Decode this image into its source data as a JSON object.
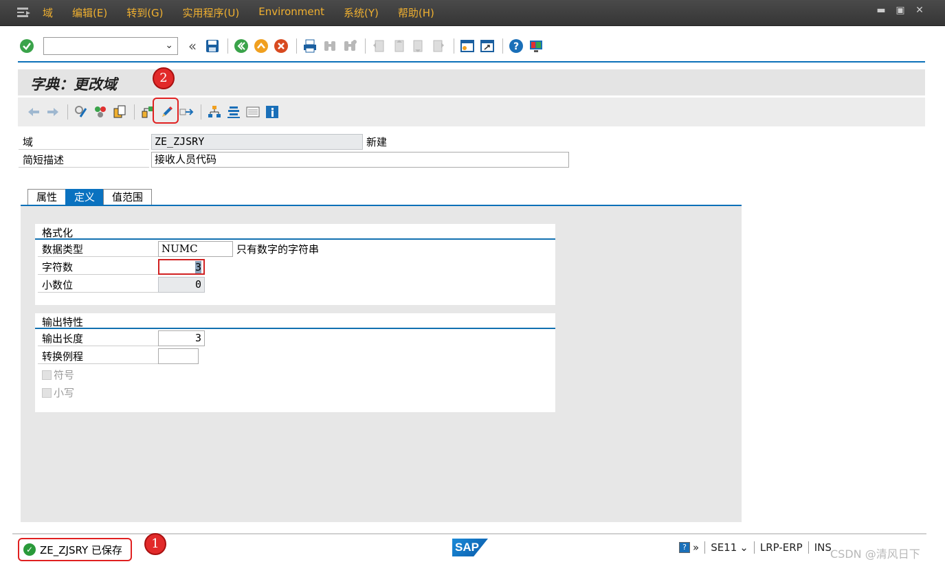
{
  "menubar": {
    "items": [
      "域",
      "编辑(E)",
      "转到(G)",
      "实用程序(U)",
      "Environment",
      "系统(Y)",
      "帮助(H)"
    ]
  },
  "header": {
    "title": "字典：更改域"
  },
  "fields": {
    "domain_label": "域",
    "domain_value": "ZE_ZJSRY",
    "domain_status": "新建",
    "desc_label": "简短描述",
    "desc_value": "接收人员代码"
  },
  "tabs": [
    {
      "label": "属性",
      "active": false
    },
    {
      "label": "定义",
      "active": true
    },
    {
      "label": "值范围",
      "active": false
    }
  ],
  "format_group": {
    "title": "格式化",
    "datatype_label": "数据类型",
    "datatype_value": "NUMC",
    "datatype_desc": "只有数字的字符串",
    "chars_label": "字符数",
    "chars_value": "3",
    "decimals_label": "小数位",
    "decimals_value": "0"
  },
  "output_group": {
    "title": "输出特性",
    "outlen_label": "输出长度",
    "outlen_value": "3",
    "conv_label": "转换例程",
    "conv_value": "",
    "sign_label": "符号",
    "lower_label": "小写"
  },
  "annotations": {
    "badge1": "1",
    "badge2": "2"
  },
  "statusbar": {
    "message": "ZE_ZJSRY 已保存",
    "sap_logo": "SAP",
    "transaction": "SE11",
    "system": "LRP-ERP",
    "mode": "INS"
  },
  "watermark": "CSDN @清风日下",
  "colors": {
    "menu_text": "#f0b030",
    "accent_blue": "#0a72c0",
    "annotation_red": "#e02020",
    "success_green": "#2a9a3a"
  },
  "icons": {
    "system_toolbar": [
      "enter-icon",
      "back-icon",
      "save-icon",
      "exit-icon",
      "cancel-icon",
      "print-icon",
      "find-icon",
      "find-next-icon",
      "first-page-icon",
      "previous-page-icon",
      "next-page-icon",
      "last-page-icon",
      "new-session-icon",
      "shortcut-icon",
      "help-icon",
      "customize-layout-icon"
    ],
    "app_toolbar": [
      "back-arrow-icon",
      "forward-arrow-icon",
      "display-change-icon",
      "other-object-icon",
      "activate-icon",
      "where-used-icon",
      "edit-pencil-icon",
      "move-icon",
      "hierarchy-icon",
      "object-list-icon",
      "display-object-icon",
      "info-icon"
    ]
  }
}
